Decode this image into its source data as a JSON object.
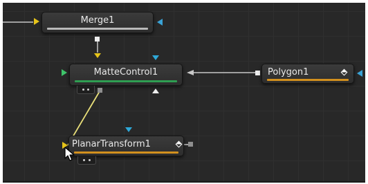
{
  "nodes": {
    "merge": {
      "label": "Merge1"
    },
    "matte_control": {
      "label": "MatteControl1"
    },
    "polygon": {
      "label": "Polygon1"
    },
    "planar_transform": {
      "label": "PlanarTransform1"
    }
  },
  "colors": {
    "canvas_bg": "#282828",
    "grid": "#2f2f2f",
    "input_yellow": "#e6c419",
    "mask_blue": "#2ea8d8",
    "effect_mask_blue": "#3aa3d6",
    "output_square": "#eeeeee",
    "merge_status": "#b9b9b9",
    "matte_status": "#2f9e52",
    "mask_status": "#d2901e",
    "wire_gray": "#c8c8c8",
    "wire_yellow": "#e9e07a"
  }
}
